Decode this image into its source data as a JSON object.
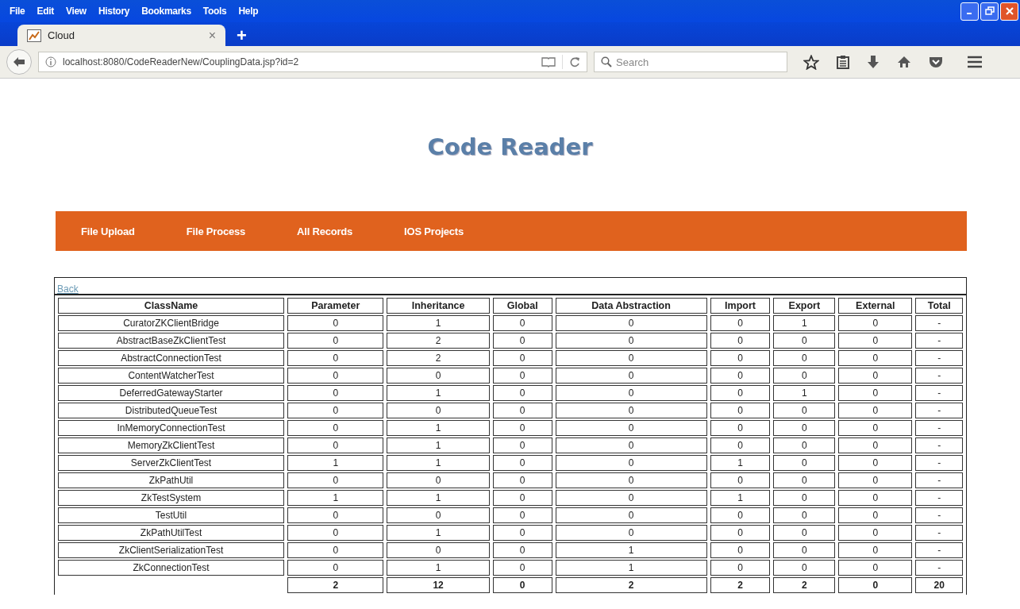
{
  "browser": {
    "menu": [
      "File",
      "Edit",
      "View",
      "History",
      "Bookmarks",
      "Tools",
      "Help"
    ],
    "tab": {
      "title": "Cloud",
      "close": "×"
    },
    "new_tab": "+",
    "url": "localhost:8080/CodeReaderNew/CouplingData.jsp?id=2",
    "search": {
      "placeholder": "Search"
    }
  },
  "page": {
    "title": "Code Reader",
    "nav": [
      "File Upload",
      "File Process",
      "All Records",
      "IOS Projects"
    ],
    "back_link": "Back",
    "table": {
      "columns": [
        "ClassName",
        "Parameter",
        "Inheritance",
        "Global",
        "Data Abstraction",
        "Import",
        "Export",
        "External",
        "Total"
      ],
      "rows": [
        [
          "CuratorZKClientBridge",
          "0",
          "1",
          "0",
          "0",
          "0",
          "1",
          "0",
          "-"
        ],
        [
          "AbstractBaseZkClientTest",
          "0",
          "2",
          "0",
          "0",
          "0",
          "0",
          "0",
          "-"
        ],
        [
          "AbstractConnectionTest",
          "0",
          "2",
          "0",
          "0",
          "0",
          "0",
          "0",
          "-"
        ],
        [
          "ContentWatcherTest",
          "0",
          "0",
          "0",
          "0",
          "0",
          "0",
          "0",
          "-"
        ],
        [
          "DeferredGatewayStarter",
          "0",
          "1",
          "0",
          "0",
          "0",
          "1",
          "0",
          "-"
        ],
        [
          "DistributedQueueTest",
          "0",
          "0",
          "0",
          "0",
          "0",
          "0",
          "0",
          "-"
        ],
        [
          "InMemoryConnectionTest",
          "0",
          "1",
          "0",
          "0",
          "0",
          "0",
          "0",
          "-"
        ],
        [
          "MemoryZkClientTest",
          "0",
          "1",
          "0",
          "0",
          "0",
          "0",
          "0",
          "-"
        ],
        [
          "ServerZkClientTest",
          "1",
          "1",
          "0",
          "0",
          "1",
          "0",
          "0",
          "-"
        ],
        [
          "ZkPathUtil",
          "0",
          "0",
          "0",
          "0",
          "0",
          "0",
          "0",
          "-"
        ],
        [
          "ZkTestSystem",
          "1",
          "1",
          "0",
          "0",
          "1",
          "0",
          "0",
          "-"
        ],
        [
          "TestUtil",
          "0",
          "0",
          "0",
          "0",
          "0",
          "0",
          "0",
          "-"
        ],
        [
          "ZkPathUtilTest",
          "0",
          "1",
          "0",
          "0",
          "0",
          "0",
          "0",
          "-"
        ],
        [
          "ZkClientSerializationTest",
          "0",
          "0",
          "0",
          "1",
          "0",
          "0",
          "0",
          "-"
        ],
        [
          "ZkConnectionTest",
          "0",
          "1",
          "0",
          "1",
          "0",
          "0",
          "0",
          "-"
        ]
      ],
      "totals": [
        "2",
        "12",
        "0",
        "2",
        "2",
        "2",
        "0",
        "20"
      ]
    }
  }
}
